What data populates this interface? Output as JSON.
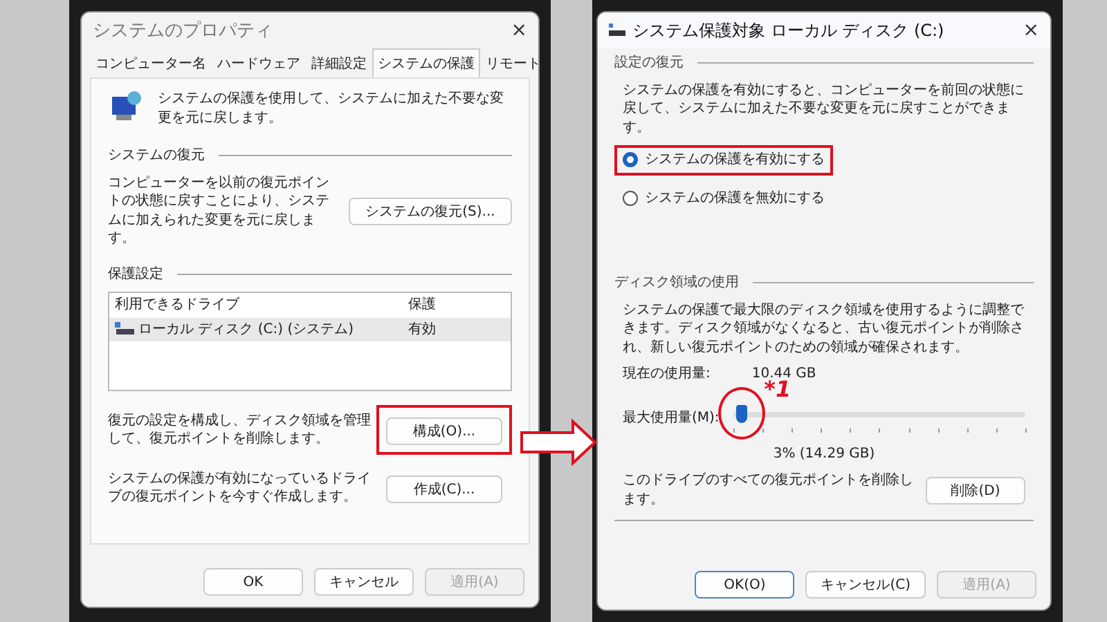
{
  "properties_dialog": {
    "title": "システムのプロパティ",
    "close": "×",
    "tabs": [
      {
        "label": "コンピューター名",
        "selected": false
      },
      {
        "label": "ハードウェア",
        "selected": false
      },
      {
        "label": "詳細設定",
        "selected": false
      },
      {
        "label": "システムの保護",
        "selected": true
      },
      {
        "label": "リモート",
        "selected": false
      }
    ],
    "intro": "システムの保護を使用して、システムに加えた不要な変更を元に戻します。",
    "restore_section": {
      "heading": "システムの復元",
      "text": "コンピューターを以前の復元ポイントの状態に戻すことにより、システムに加えられた変更を元に戻します。",
      "button": "システムの復元(S)..."
    },
    "protection_section": {
      "heading": "保護設定",
      "columns": [
        "利用できるドライブ",
        "保護"
      ],
      "rows": [
        {
          "drive": "ローカル ディスク (C:) (システム)",
          "protection": "有効",
          "selected": true
        }
      ],
      "actions": [
        {
          "text": "復元の設定を構成し、ディスク領域を管理して、復元ポイントを削除します。",
          "button": "構成(O)...",
          "highlighted": true
        },
        {
          "text": "システムの保護が有効になっているドライブの復元ポイントを今すぐ作成します。",
          "button": "作成(C)...",
          "highlighted": false
        }
      ]
    },
    "buttons": [
      {
        "label": "OK",
        "disabled": false
      },
      {
        "label": "キャンセル",
        "disabled": false
      },
      {
        "label": "適用(A)",
        "disabled": true
      }
    ]
  },
  "drive_dialog": {
    "title": "システム保護対象 ローカル ディスク (C:)",
    "close": "×",
    "restore_settings": {
      "heading": "設定の復元",
      "text": "システムの保護を有効にすると、コンピューターを前回の状態に戻して、システムに加えた不要な変更を元に戻すことができます。",
      "options": [
        {
          "label": "システムの保護を有効にする",
          "selected": true,
          "highlighted": true
        },
        {
          "label": "システムの保護を無効にする",
          "selected": false,
          "highlighted": false
        }
      ]
    },
    "disk_usage": {
      "heading": "ディスク領域の使用",
      "text": "システムの保護で最大限のディスク領域を使用するように調整できます。ディスク領域がなくなると、古い復元ポイントが削除され、新しい復元ポイントのための領域が確保されます。",
      "current_label": "現在の使用量:",
      "current_value": "10.44 GB",
      "max_label": "最大使用量(M):",
      "level": 0.03,
      "marker": "*1",
      "reading": "3% (14.29 GB)",
      "delete_text": "このドライブのすべての復元ポイントを削除します。",
      "delete_button": "削除(D)"
    },
    "buttons": [
      {
        "label": "OK(O)",
        "disabled": false,
        "default": true
      },
      {
        "label": "キャンセル(C)",
        "disabled": false,
        "default": false
      },
      {
        "label": "適用(A)",
        "disabled": true,
        "default": false
      }
    ]
  }
}
